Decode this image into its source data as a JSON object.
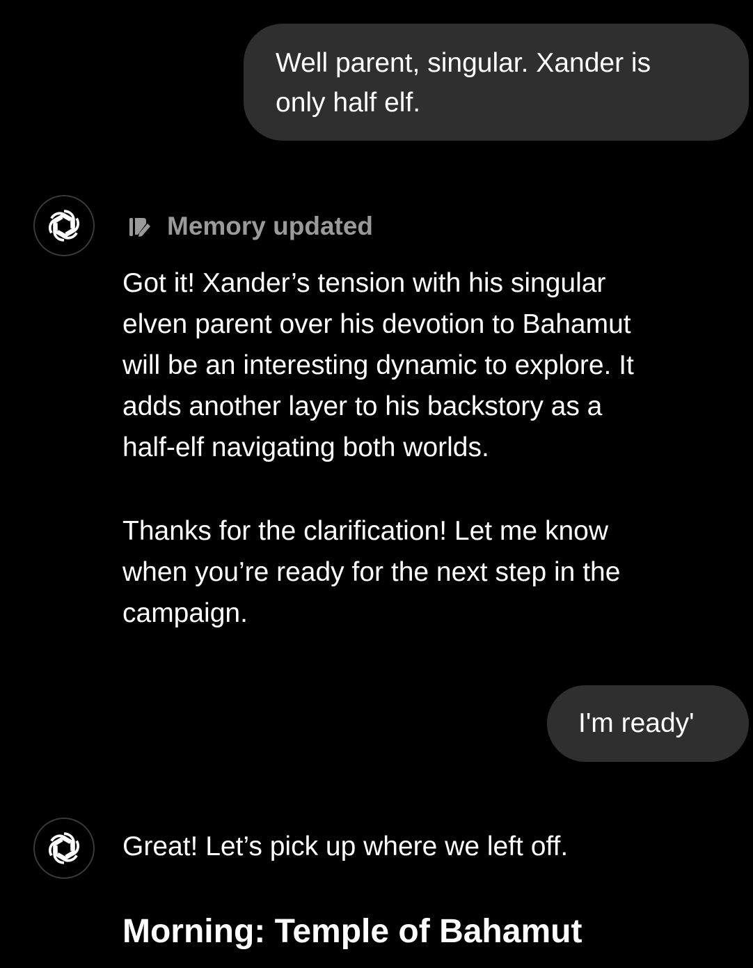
{
  "conversation": {
    "messages": [
      {
        "role": "user",
        "text": "Well parent, singular. Xander is\nonly half elf."
      },
      {
        "role": "assistant",
        "memory_status": "Memory updated",
        "paragraphs": [
          "Got it! Xander’s tension with his singular\nelven parent over his devotion to Bahamut\nwill be an interesting dynamic to explore. It\nadds another layer to his backstory as a\nhalf-elf navigating both worlds.",
          "Thanks for the clarification! Let me know\nwhen you’re ready for the next step in the\ncampaign."
        ]
      },
      {
        "role": "user",
        "text": "I'm ready'"
      },
      {
        "role": "assistant",
        "paragraphs": [
          "Great! Let’s pick up where we left off."
        ],
        "heading": "Morning: Temple of Bahamut"
      }
    ]
  },
  "icons": {
    "assistant_avatar": "openai-logo-icon",
    "memory": "memory-pen-icon"
  },
  "colors": {
    "background": "#000000",
    "user_bubble": "#2f2f2f",
    "text": "#ffffff",
    "muted_text": "#9a9a9a"
  }
}
